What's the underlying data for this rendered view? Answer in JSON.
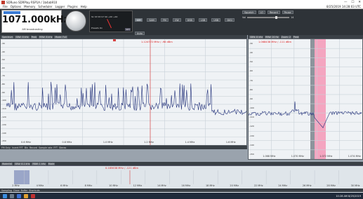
{
  "window": {
    "title": "SDRuno  SDRPlay RSP1A / 1b4ab910",
    "controls": [
      "—",
      "☐",
      "✕"
    ]
  },
  "menu": {
    "items": [
      "File",
      "Options",
      "Memory",
      "Scheduler",
      "Logger",
      "Plugins",
      "Help"
    ],
    "clock": "8/25/2019 14:28:03 UTC"
  },
  "tuner": {
    "small_label": "GEN 1071.000kHz",
    "frequency": "1071.000kHz",
    "mode": "AM broadcasting",
    "smeter_scale": "S1   S3   S5   S7   S9  +20  +40",
    "smeter_preset": "Presets On",
    "apply": "SET"
  },
  "mode_buttons": [
    "AM",
    "SAM",
    "FM",
    "CW",
    "DSB",
    "LSB",
    "USB",
    "DIGI",
    "Auto"
  ],
  "bandwidth_buttons": [
    "500",
    "1K",
    "2K",
    "3K",
    "5K",
    "8K",
    "15K",
    "20K"
  ],
  "agc": {
    "label": "AGC",
    "mode": "Tuning",
    "fm_tuning_label": "FM tuning",
    "fm_tuning_value": "1,000 kHz",
    "reset": "Reset",
    "presets_label": "EXT Presets"
  },
  "right_controls": {
    "squelch": "Squelch",
    "lo": "LO",
    "record": "Record",
    "pause": "Pause",
    "volume": "Vol",
    "value": "14"
  },
  "main": {
    "toolbar": [
      "Spectrum",
      "SBW: 8 kHz",
      "Peak",
      "RBW: 8 kHz",
      "Mode: Full"
    ],
    "readout": "1.124772 MHz / -98 dBm",
    "y_labels": [
      "-30",
      "-40",
      "-50",
      "-60",
      "-70",
      "-80",
      "-90",
      "-100",
      "-110",
      "-120",
      "-130",
      "-140",
      "-150"
    ],
    "x_labels": [
      "0.6 MHz",
      "0.8 MHz",
      "1.0 MHz",
      "1.2 MHz",
      "1.4 MHz",
      "1.6 MHz"
    ],
    "footer": [
      "FM Only",
      "Invert FFT",
      "Bin",
      "Record",
      "Sample rate",
      "FFT",
      "Stereo"
    ]
  },
  "side": {
    "toolbar": [
      "SBW: 8 kHz",
      "RBW: 20 Hz",
      "Zoom: 2",
      "Peak"
    ],
    "readout": "1.068438 MHz / -111 dBm",
    "y_labels": [
      "-30",
      "-40",
      "-50",
      "-60",
      "-70",
      "-80",
      "-90",
      "-100",
      "-110",
      "-120",
      "-130",
      "-140",
      "-150"
    ],
    "x_labels": [
      "1.068 MHz",
      "1.070 MHz",
      "1.072 MHz",
      "1.074 MHz"
    ]
  },
  "lower": {
    "toolbar": [
      "Waterfall",
      "SBW: 8.1 kHz",
      "RBW: 1 kHz",
      "Mode"
    ],
    "readout": "0.185638 MHz / -121 dBm",
    "x_labels": [
      "2 MHz",
      "4 MHz",
      "6 MHz",
      "8 MHz",
      "10 MHz",
      "12 MHz",
      "14 MHz",
      "16 MHz",
      "18 MHz",
      "20 MHz",
      "22 MHz",
      "24 MHz",
      "26 MHz",
      "28 MHz",
      "30 MHz"
    ],
    "footer": [
      "Sampling",
      "Close",
      "Buffer",
      "Shortcuts"
    ]
  },
  "taskbar": {
    "clock": "10:28 AM  8/25/2019"
  },
  "colors": {
    "trace": "#21307a",
    "marker": "#d44444",
    "highlight": "#f4a5c0"
  }
}
